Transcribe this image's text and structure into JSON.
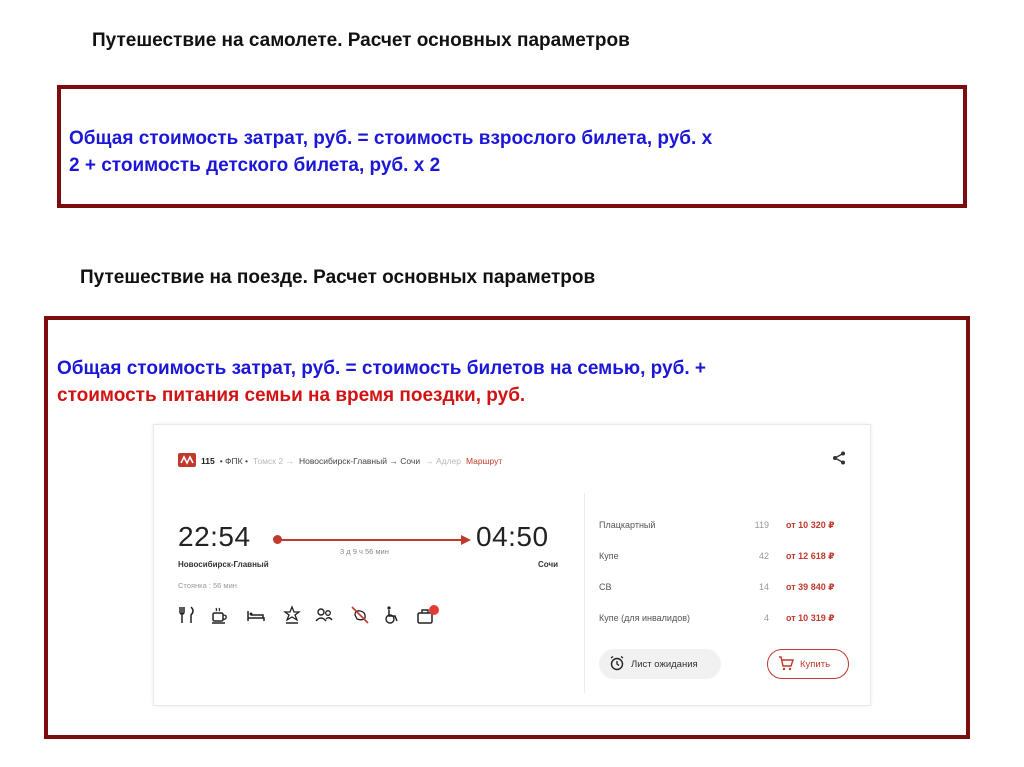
{
  "plane": {
    "heading": "Путешествие на самолете. Расчет основных параметров",
    "formula_line1": "Общая стоимость затрат, руб. = стоимость взрослого билета, руб. х",
    "formula_line2": "2 + стоимость детского билета, руб. х 2"
  },
  "train": {
    "heading": "Путешествие на поезде. Расчет основных параметров",
    "formula_line1": "Общая стоимость затрат, руб. =  стоимость билетов на семью, руб. +",
    "formula_line2": "стоимость питания семьи на время поездки, руб."
  },
  "ticket": {
    "train_number": "115",
    "carrier": "• ФПК •",
    "route_from_muted": "Томск 2 →",
    "route_main": "Новосибирск-Главный → Сочи",
    "route_to_muted": "→ Адлер",
    "route_link": "Маршрут",
    "departure_time": "22:54",
    "arrival_time": "04:50",
    "departure_station": "Новосибирск-Главный",
    "arrival_station": "Сочи",
    "stop_info": "Стоянка : 56 мин",
    "duration": "3 д 9 ч 56 мин",
    "badge_count": "16",
    "amenities": [
      "restaurant-icon",
      "coffee-icon",
      "bed-icon",
      "award-icon",
      "people-icon",
      "no-pets-icon",
      "wheelchair-icon",
      "luggage-icon"
    ],
    "classes": [
      {
        "name": "Плацкартный",
        "seats": "119",
        "price": "от 10 320 ₽"
      },
      {
        "name": "Купе",
        "seats": "42",
        "price": "от 12 618 ₽"
      },
      {
        "name": "СВ",
        "seats": "14",
        "price": "от 39 840 ₽"
      },
      {
        "name": "Купе (для инвалидов)",
        "seats": "4",
        "price": "от 10 319 ₽"
      }
    ],
    "waitlist_label": "Лист ожидания",
    "buy_label": "Купить"
  },
  "colors": {
    "frame": "#7a0d0d",
    "formula_blue": "#1c17d8",
    "formula_red": "#d11313",
    "accent": "#c0392b"
  }
}
